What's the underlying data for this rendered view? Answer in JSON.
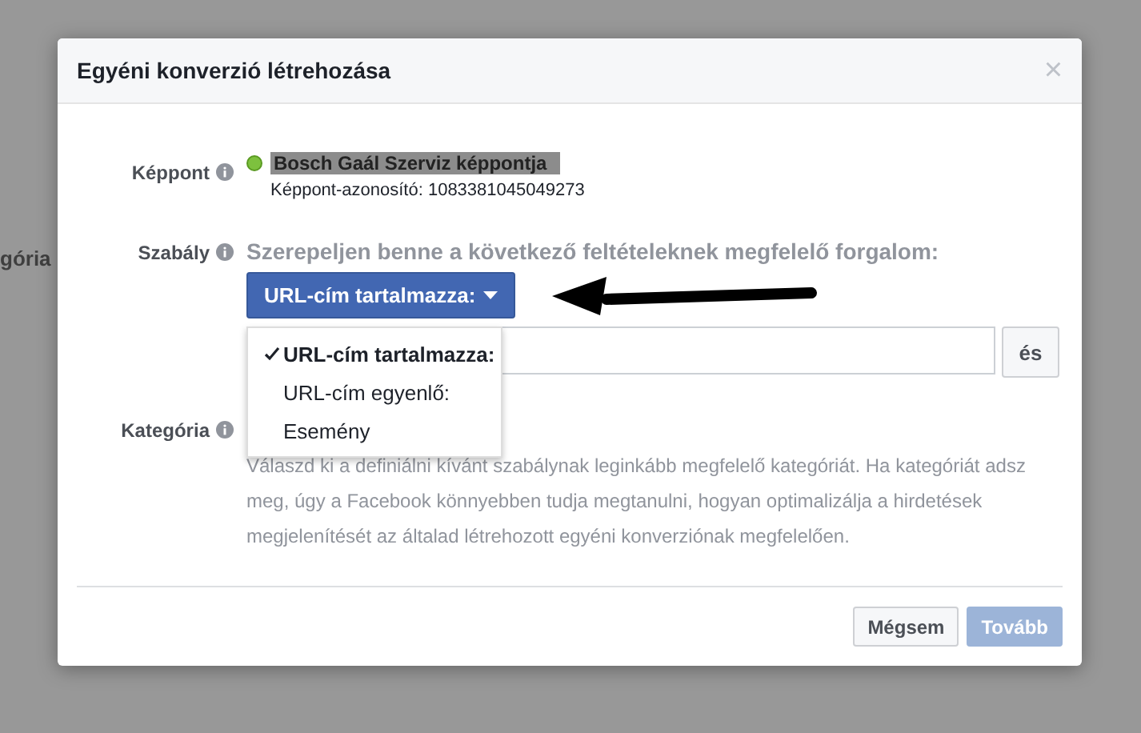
{
  "backdrop": {
    "label": "gória"
  },
  "dialog": {
    "title": "Egyéni konverzió létrehozása",
    "close": "×"
  },
  "pixel": {
    "label": "Képpont",
    "name": "Bosch Gaál Szerviz képpontja",
    "id_line": "Képpont-azonosító: 1083381045049273",
    "active": true
  },
  "rule": {
    "label": "Szabály",
    "text": "Szerepeljen benne a következő feltételeknek megfelelő forgalom:",
    "dropdown": "URL-cím tartalmazza:",
    "and_button": "és",
    "options": [
      {
        "label": "URL-cím tartalmazza:",
        "selected": true
      },
      {
        "label": "URL-cím egyenlő:",
        "selected": false
      },
      {
        "label": "Esemény",
        "selected": false
      }
    ]
  },
  "category": {
    "label": "Kategória",
    "help": "Válaszd ki a definiálni kívánt szabálynak leginkább megfelelő kategóriát. Ha kategóriát adsz meg, úgy a Facebook könnyebben tudja megtanulni, hogyan optimalizálja a hirdetések megjelenítését az általad létrehozott egyéni konverziónak megfelelően."
  },
  "buttons": [
    {
      "label": "Mégsem",
      "kind": "secondary",
      "disabled": false
    },
    {
      "label": "Tovább",
      "kind": "primary",
      "disabled": true
    }
  ]
}
